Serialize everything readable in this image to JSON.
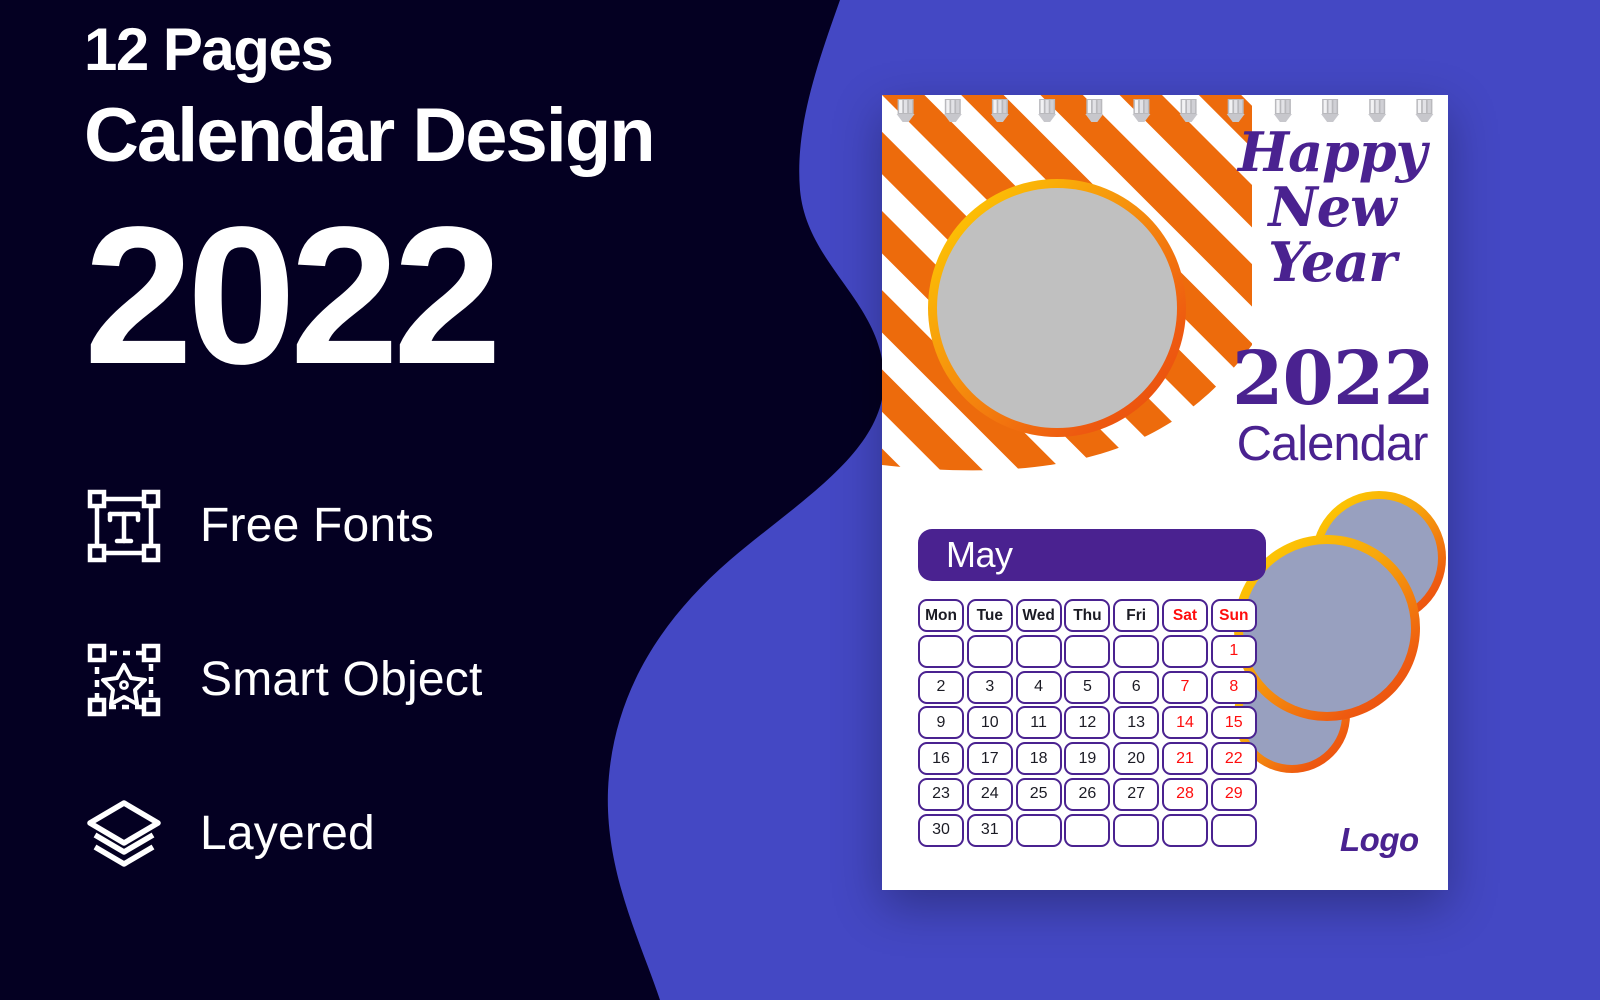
{
  "palette": {
    "navy": "#040022",
    "blue": "#4448C4",
    "white": "#FFFFFF",
    "purple": "#4A2290",
    "orange": "#ED6B0C",
    "orange_dark": "#E8490D",
    "yellow": "#FFD400",
    "red": "#FF0D0D",
    "gray_photo": "#C0C0C0",
    "gray_logo": "#98A0BF"
  },
  "promo": {
    "line1": "12 Pages",
    "line2": "Calendar Design",
    "line3": "2022",
    "features": [
      {
        "icon": "text-frame-icon",
        "label": "Free Fonts"
      },
      {
        "icon": "smart-object-icon",
        "label": "Smart Object"
      },
      {
        "icon": "layers-icon",
        "label": "Layered"
      }
    ]
  },
  "calendar": {
    "greeting": {
      "line1": "Happy",
      "line2": "New",
      "line3": "Year"
    },
    "year": "2022",
    "calendar_word": "Calendar",
    "month": "May",
    "logo_text": "Logo",
    "weekdays": [
      {
        "label": "Mon",
        "weekend": false
      },
      {
        "label": "Tue",
        "weekend": false
      },
      {
        "label": "Wed",
        "weekend": false
      },
      {
        "label": "Thu",
        "weekend": false
      },
      {
        "label": "Fri",
        "weekend": false
      },
      {
        "label": "Sat",
        "weekend": true
      },
      {
        "label": "Sun",
        "weekend": true
      }
    ],
    "weeks": [
      [
        "",
        "",
        "",
        "",
        "",
        "",
        "1"
      ],
      [
        "2",
        "3",
        "4",
        "5",
        "6",
        "7",
        "8"
      ],
      [
        "9",
        "10",
        "11",
        "12",
        "13",
        "14",
        "15"
      ],
      [
        "16",
        "17",
        "18",
        "19",
        "20",
        "21",
        "22"
      ],
      [
        "23",
        "24",
        "25",
        "26",
        "27",
        "28",
        "29"
      ],
      [
        "30",
        "31",
        "",
        "",
        "",
        "",
        ""
      ]
    ],
    "weekend_columns": [
      5,
      6
    ],
    "spiral_ring_count": 12,
    "photo_placeholders": 4
  }
}
